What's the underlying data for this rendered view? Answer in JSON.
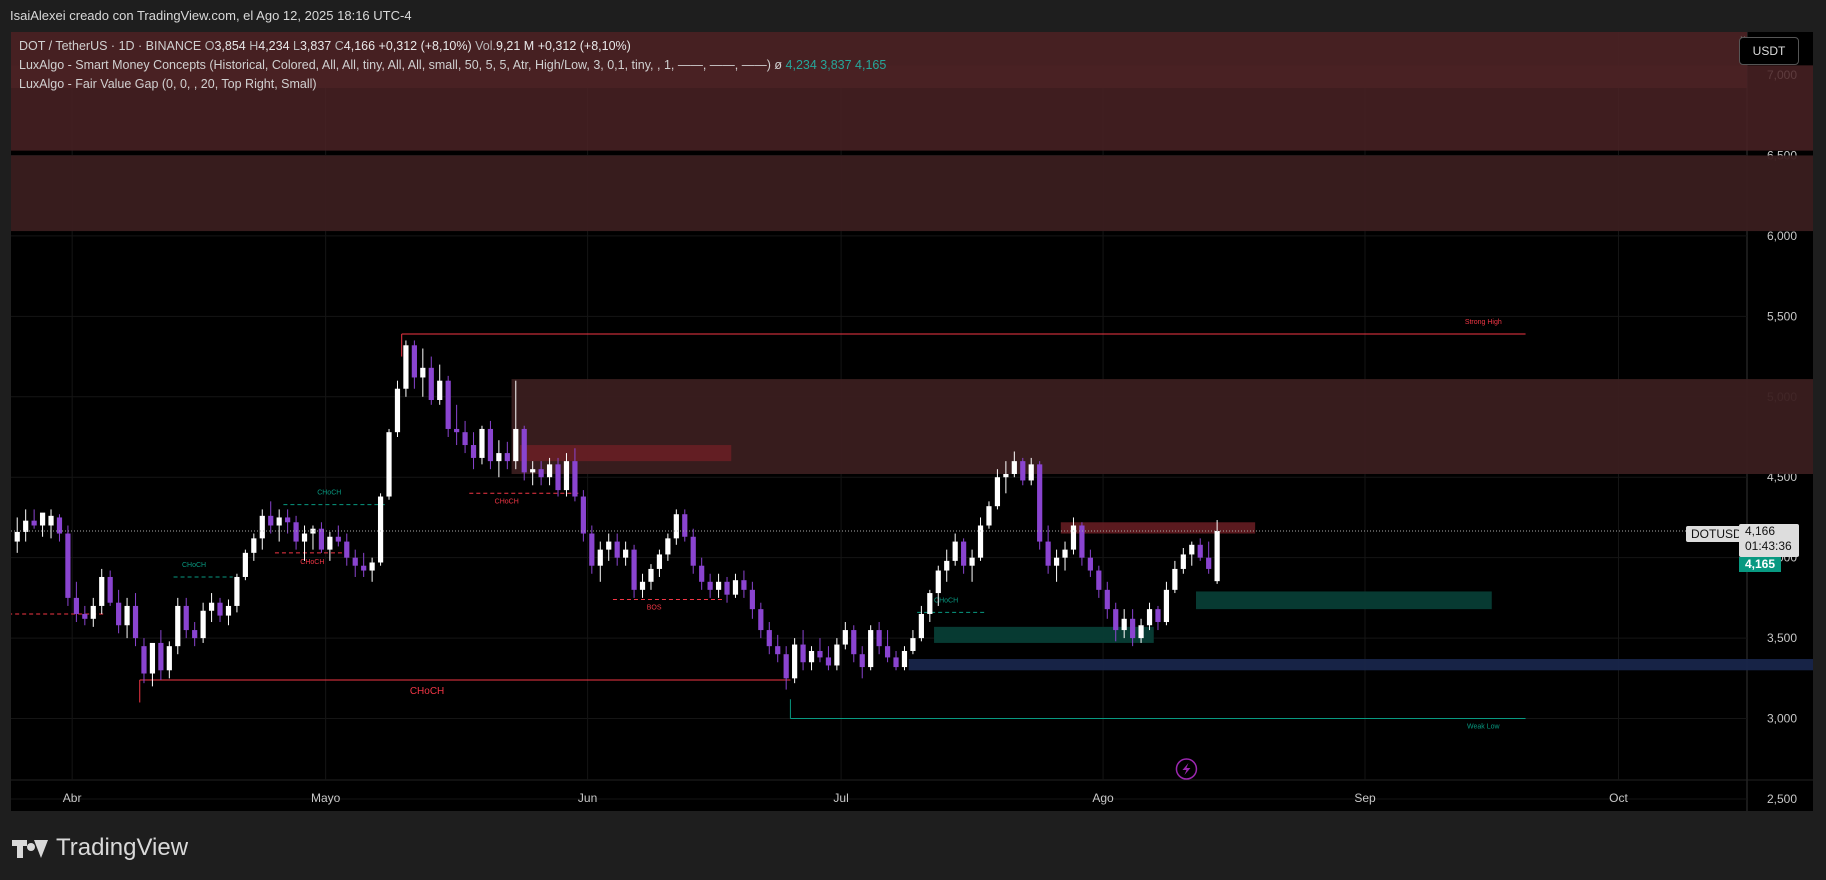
{
  "header": {
    "title": "IsaiAlexei creado con TradingView.com, el Ago 12, 2025 18:16 UTC-4"
  },
  "legend": {
    "symbol": "DOT / TetherUS · 1D · BINANCE",
    "o_label": "O",
    "o_val": "3,854",
    "h_label": "H",
    "h_val": "4,234",
    "l_label": "L",
    "l_val": "3,837",
    "c_label": "C",
    "c_val": "4,166",
    "change": "+0,312 (+8,10%)",
    "vol_label": "Vol.",
    "vol_val": "9,21 M",
    "vol_change": "+0,312 (+8,10%)",
    "ind1": "LuxAlgo - Smart Money Concepts (Historical, Colored, All, All, tiny, All, All, small, 50, 5, 5, Atr, High/Low, 3, 0,1, tiny, , 1, ——, ——, ——)",
    "ind1_sym": "ø",
    "ind1_vals": [
      "4,234",
      "3,837",
      "4,165"
    ],
    "ind2": "LuxAlgo - Fair Value Gap (0, 0, , 20, Top Right, Small)"
  },
  "currency_button": "USDT",
  "close_glyph": "×",
  "price_tags": {
    "symbol": "DOTUSDT",
    "last": "4,166",
    "countdown": "01:43:36",
    "smc": "4,165"
  },
  "logo_text": "TradingView",
  "annotations": {
    "strong_high": "Strong High",
    "weak_low": "Weak Low",
    "choch_main": "CHoCH",
    "bos": "BOS",
    "choch": "CHoCH"
  },
  "colors": {
    "bull": "#ffffff",
    "bear": "#8a44d0",
    "choch_bear": "#f23645",
    "choch_bull": "#089981",
    "ob_bear": "#4a2022",
    "ob_bull": "#073a33",
    "ob_blue": "#1a2744"
  },
  "chart_data": {
    "type": "candlestick",
    "symbol": "DOTUSDT",
    "timeframe": "1D",
    "y_ticks": [
      "7,000",
      "6,500",
      "6,000",
      "5,500",
      "5,000",
      "4,500",
      "4,000",
      "3,500",
      "3,000",
      "2,500"
    ],
    "y_tick_values": [
      7.0,
      6.5,
      6.0,
      5.5,
      5.0,
      4.5,
      4.0,
      3.5,
      3.0,
      2.5
    ],
    "ylim": [
      2.45,
      7.45
    ],
    "x_ticks": [
      {
        "label": "Abr",
        "date": "2025-04-01"
      },
      {
        "label": "Mayo",
        "date": "2025-05-01"
      },
      {
        "label": "Jun",
        "date": "2025-06-01"
      },
      {
        "label": "Jul",
        "date": "2025-07-01"
      },
      {
        "label": "Ago",
        "date": "2025-08-01"
      },
      {
        "label": "Sep",
        "date": "2025-09-01"
      },
      {
        "label": "Oct",
        "date": "2025-10-01"
      }
    ],
    "first_date": "2025-03-25",
    "last_price": 4.166,
    "candles": [
      [
        4.1,
        4.25,
        4.03,
        4.16
      ],
      [
        4.16,
        4.3,
        4.1,
        4.23
      ],
      [
        4.23,
        4.3,
        4.18,
        4.2
      ],
      [
        4.2,
        4.27,
        4.13,
        4.28
      ],
      [
        4.2,
        4.3,
        4.12,
        4.26
      ],
      [
        4.25,
        4.27,
        4.1,
        4.15
      ],
      [
        4.15,
        4.2,
        3.7,
        3.75
      ],
      [
        3.75,
        3.85,
        3.6,
        3.65
      ],
      [
        3.65,
        3.7,
        3.58,
        3.62
      ],
      [
        3.62,
        3.75,
        3.57,
        3.7
      ],
      [
        3.7,
        3.93,
        3.65,
        3.88
      ],
      [
        3.88,
        3.92,
        3.7,
        3.72
      ],
      [
        3.72,
        3.8,
        3.53,
        3.58
      ],
      [
        3.58,
        3.75,
        3.5,
        3.7
      ],
      [
        3.7,
        3.78,
        3.45,
        3.5
      ],
      [
        3.45,
        3.5,
        3.22,
        3.28
      ],
      [
        3.28,
        3.45,
        3.2,
        3.47
      ],
      [
        3.47,
        3.55,
        3.24,
        3.3
      ],
      [
        3.3,
        3.48,
        3.25,
        3.45
      ],
      [
        3.45,
        3.75,
        3.4,
        3.7
      ],
      [
        3.7,
        3.75,
        3.5,
        3.55
      ],
      [
        3.55,
        3.6,
        3.45,
        3.5
      ],
      [
        3.5,
        3.72,
        3.47,
        3.67
      ],
      [
        3.67,
        3.78,
        3.6,
        3.72
      ],
      [
        3.72,
        3.75,
        3.6,
        3.64
      ],
      [
        3.64,
        3.74,
        3.58,
        3.7
      ],
      [
        3.7,
        3.9,
        3.66,
        3.88
      ],
      [
        3.88,
        4.05,
        3.86,
        4.03
      ],
      [
        4.03,
        4.15,
        3.98,
        4.12
      ],
      [
        4.12,
        4.3,
        4.05,
        4.26
      ],
      [
        4.26,
        4.35,
        4.15,
        4.2
      ],
      [
        4.2,
        4.3,
        4.1,
        4.25
      ],
      [
        4.25,
        4.3,
        4.15,
        4.22
      ],
      [
        4.22,
        4.26,
        4.05,
        4.1
      ],
      [
        4.1,
        4.2,
        3.98,
        4.15
      ],
      [
        4.15,
        4.2,
        4.05,
        4.18
      ],
      [
        4.18,
        4.22,
        4.03,
        4.05
      ],
      [
        4.05,
        4.16,
        3.98,
        4.13
      ],
      [
        4.13,
        4.2,
        4.07,
        4.1
      ],
      [
        4.1,
        4.15,
        3.95,
        4.0
      ],
      [
        4.0,
        4.05,
        3.88,
        3.95
      ],
      [
        3.95,
        4.03,
        3.88,
        3.92
      ],
      [
        3.92,
        4.0,
        3.85,
        3.97
      ],
      [
        3.97,
        4.4,
        3.95,
        4.38
      ],
      [
        4.38,
        4.8,
        4.36,
        4.78
      ],
      [
        4.78,
        5.1,
        4.75,
        5.05
      ],
      [
        5.05,
        5.35,
        5.0,
        5.32
      ],
      [
        5.32,
        5.35,
        5.05,
        5.12
      ],
      [
        5.12,
        5.3,
        5.0,
        5.18
      ],
      [
        5.18,
        5.25,
        4.95,
        4.98
      ],
      [
        4.98,
        5.2,
        4.95,
        5.1
      ],
      [
        5.1,
        5.13,
        4.75,
        4.8
      ],
      [
        4.8,
        4.95,
        4.7,
        4.78
      ],
      [
        4.78,
        4.85,
        4.65,
        4.7
      ],
      [
        4.7,
        4.78,
        4.55,
        4.62
      ],
      [
        4.62,
        4.82,
        4.58,
        4.8
      ],
      [
        4.8,
        4.85,
        4.55,
        4.6
      ],
      [
        4.6,
        4.73,
        4.5,
        4.65
      ],
      [
        4.65,
        4.72,
        4.55,
        4.6
      ],
      [
        4.6,
        5.1,
        4.55,
        4.8
      ],
      [
        4.8,
        4.82,
        4.48,
        4.53
      ],
      [
        4.53,
        4.6,
        4.45,
        4.55
      ],
      [
        4.55,
        4.6,
        4.45,
        4.5
      ],
      [
        4.5,
        4.62,
        4.45,
        4.58
      ],
      [
        4.58,
        4.62,
        4.38,
        4.42
      ],
      [
        4.42,
        4.65,
        4.38,
        4.6
      ],
      [
        4.6,
        4.68,
        4.35,
        4.38
      ],
      [
        4.38,
        4.42,
        4.1,
        4.15
      ],
      [
        4.15,
        4.2,
        3.9,
        3.95
      ],
      [
        3.95,
        4.1,
        3.85,
        4.05
      ],
      [
        4.05,
        4.15,
        3.98,
        4.1
      ],
      [
        4.1,
        4.15,
        3.95,
        4.0
      ],
      [
        4.0,
        4.1,
        3.95,
        4.05
      ],
      [
        4.05,
        4.08,
        3.75,
        3.8
      ],
      [
        3.8,
        3.9,
        3.75,
        3.85
      ],
      [
        3.85,
        3.96,
        3.8,
        3.93
      ],
      [
        3.93,
        4.05,
        3.88,
        4.02
      ],
      [
        4.02,
        4.15,
        3.98,
        4.12
      ],
      [
        4.12,
        4.3,
        4.08,
        4.27
      ],
      [
        4.27,
        4.3,
        4.1,
        4.13
      ],
      [
        4.13,
        4.18,
        3.9,
        3.95
      ],
      [
        3.95,
        4.0,
        3.8,
        3.85
      ],
      [
        3.85,
        3.9,
        3.75,
        3.8
      ],
      [
        3.8,
        3.9,
        3.75,
        3.85
      ],
      [
        3.85,
        3.88,
        3.72,
        3.77
      ],
      [
        3.77,
        3.9,
        3.75,
        3.86
      ],
      [
        3.86,
        3.92,
        3.75,
        3.8
      ],
      [
        3.8,
        3.85,
        3.62,
        3.68
      ],
      [
        3.68,
        3.72,
        3.5,
        3.55
      ],
      [
        3.55,
        3.6,
        3.4,
        3.45
      ],
      [
        3.45,
        3.52,
        3.35,
        3.4
      ],
      [
        3.4,
        3.45,
        3.18,
        3.25
      ],
      [
        3.25,
        3.5,
        3.22,
        3.46
      ],
      [
        3.46,
        3.55,
        3.3,
        3.35
      ],
      [
        3.35,
        3.45,
        3.3,
        3.42
      ],
      [
        3.42,
        3.5,
        3.35,
        3.38
      ],
      [
        3.38,
        3.45,
        3.3,
        3.33
      ],
      [
        3.33,
        3.5,
        3.3,
        3.46
      ],
      [
        3.46,
        3.6,
        3.43,
        3.55
      ],
      [
        3.55,
        3.58,
        3.35,
        3.4
      ],
      [
        3.4,
        3.45,
        3.25,
        3.32
      ],
      [
        3.32,
        3.58,
        3.3,
        3.55
      ],
      [
        3.55,
        3.6,
        3.4,
        3.45
      ],
      [
        3.45,
        3.55,
        3.35,
        3.38
      ],
      [
        3.38,
        3.42,
        3.3,
        3.32
      ],
      [
        3.32,
        3.45,
        3.3,
        3.42
      ],
      [
        3.42,
        3.55,
        3.4,
        3.5
      ],
      [
        3.5,
        3.7,
        3.48,
        3.65
      ],
      [
        3.65,
        3.8,
        3.6,
        3.78
      ],
      [
        3.78,
        3.95,
        3.7,
        3.92
      ],
      [
        3.92,
        4.05,
        3.85,
        3.98
      ],
      [
        3.98,
        4.15,
        3.95,
        4.1
      ],
      [
        4.1,
        4.12,
        3.9,
        3.95
      ],
      [
        3.95,
        4.05,
        3.85,
        4.0
      ],
      [
        4.0,
        4.25,
        3.98,
        4.2
      ],
      [
        4.2,
        4.35,
        4.18,
        4.32
      ],
      [
        4.32,
        4.55,
        4.3,
        4.5
      ],
      [
        4.5,
        4.6,
        4.4,
        4.52
      ],
      [
        4.52,
        4.66,
        4.5,
        4.6
      ],
      [
        4.6,
        4.62,
        4.45,
        4.48
      ],
      [
        4.48,
        4.62,
        4.45,
        4.58
      ],
      [
        4.58,
        4.6,
        4.05,
        4.1
      ],
      [
        4.1,
        4.2,
        3.9,
        3.95
      ],
      [
        3.95,
        4.05,
        3.85,
        4.0
      ],
      [
        4.0,
        4.1,
        3.92,
        4.05
      ],
      [
        4.05,
        4.25,
        4.02,
        4.2
      ],
      [
        4.2,
        4.22,
        3.95,
        4.0
      ],
      [
        4.0,
        4.05,
        3.88,
        3.92
      ],
      [
        3.92,
        3.95,
        3.75,
        3.8
      ],
      [
        3.8,
        3.85,
        3.62,
        3.68
      ],
      [
        3.68,
        3.72,
        3.48,
        3.55
      ],
      [
        3.55,
        3.68,
        3.5,
        3.62
      ],
      [
        3.62,
        3.68,
        3.45,
        3.5
      ],
      [
        3.5,
        3.62,
        3.47,
        3.58
      ],
      [
        3.58,
        3.72,
        3.55,
        3.68
      ],
      [
        3.68,
        3.7,
        3.55,
        3.6
      ],
      [
        3.6,
        3.85,
        3.58,
        3.8
      ],
      [
        3.8,
        3.98,
        3.78,
        3.93
      ],
      [
        3.93,
        4.06,
        3.9,
        4.02
      ],
      [
        4.02,
        4.1,
        3.95,
        4.08
      ],
      [
        4.08,
        4.12,
        3.98,
        4.0
      ],
      [
        4.0,
        4.1,
        3.9,
        3.93
      ],
      [
        3.854,
        4.234,
        3.837,
        4.166
      ]
    ],
    "boxes": [
      {
        "kind": "fvg_bear",
        "from": -13,
        "to": 238,
        "top": 7.06,
        "bottom": 6.53
      },
      {
        "kind": "ob_bear",
        "from": -13,
        "to": 238,
        "top": 6.5,
        "bottom": 6.03
      },
      {
        "kind": "ob_bear",
        "from": 59,
        "to": 238,
        "top": 5.11,
        "bottom": 4.52
      },
      {
        "kind": "fvg_bear2",
        "from": 60,
        "to": 85,
        "top": 4.7,
        "bottom": 4.6
      },
      {
        "kind": "fvg_bear2",
        "from": 124,
        "to": 147,
        "top": 4.22,
        "bottom": 4.15
      },
      {
        "kind": "fvg_bull",
        "from": 109,
        "to": 135,
        "top": 3.57,
        "bottom": 3.47
      },
      {
        "kind": "fvg_bull",
        "from": 140,
        "to": 175,
        "top": 3.79,
        "bottom": 3.68
      },
      {
        "kind": "blue",
        "from": 106,
        "to": 238,
        "top": 3.37,
        "bottom": 3.3
      }
    ],
    "lines": [
      {
        "kind": "strong_high",
        "from": 46,
        "to": 179,
        "y": 5.39,
        "color": "#f23645",
        "label": "Strong High",
        "label_x": 174,
        "label_dy": -10
      },
      {
        "kind": "choch_red",
        "from": 15,
        "to": 92,
        "y": 3.24,
        "color": "#f23645",
        "label": "CHoCH",
        "label_x": 49,
        "label_dy": 14
      },
      {
        "kind": "weak_low",
        "from": 92,
        "to": 179,
        "y": 3.0,
        "color": "#089981",
        "label": "Weak Low",
        "label_x": 174,
        "label_dy": 10
      }
    ],
    "dashed": [
      {
        "from": -13,
        "to": 11,
        "y": 3.65,
        "color": "#f23645",
        "label": "BOS",
        "label_x": -12,
        "label_dy": 10
      },
      {
        "from": 19,
        "to": 26,
        "y": 3.88,
        "color": "#089981",
        "label": "CHoCH",
        "label_x": 20,
        "label_dy": -10
      },
      {
        "from": 32,
        "to": 44,
        "y": 4.33,
        "color": "#089981",
        "label": "CHoCH",
        "label_x": 36,
        "label_dy": -10
      },
      {
        "from": 31,
        "to": 40,
        "y": 4.03,
        "color": "#f23645",
        "label": "CHoCH",
        "label_x": 34,
        "label_dy": 11
      },
      {
        "from": 54,
        "to": 67,
        "y": 4.4,
        "color": "#f23645",
        "label": "CHoCH",
        "label_x": 57,
        "label_dy": 10
      },
      {
        "from": 71,
        "to": 84,
        "y": 3.74,
        "color": "#f23645",
        "label": "BOS",
        "label_x": 75,
        "label_dy": 10
      },
      {
        "from": 107,
        "to": 115,
        "y": 3.66,
        "color": "#089981",
        "label": "CHoCH",
        "label_x": 109,
        "label_dy": -10
      }
    ]
  }
}
